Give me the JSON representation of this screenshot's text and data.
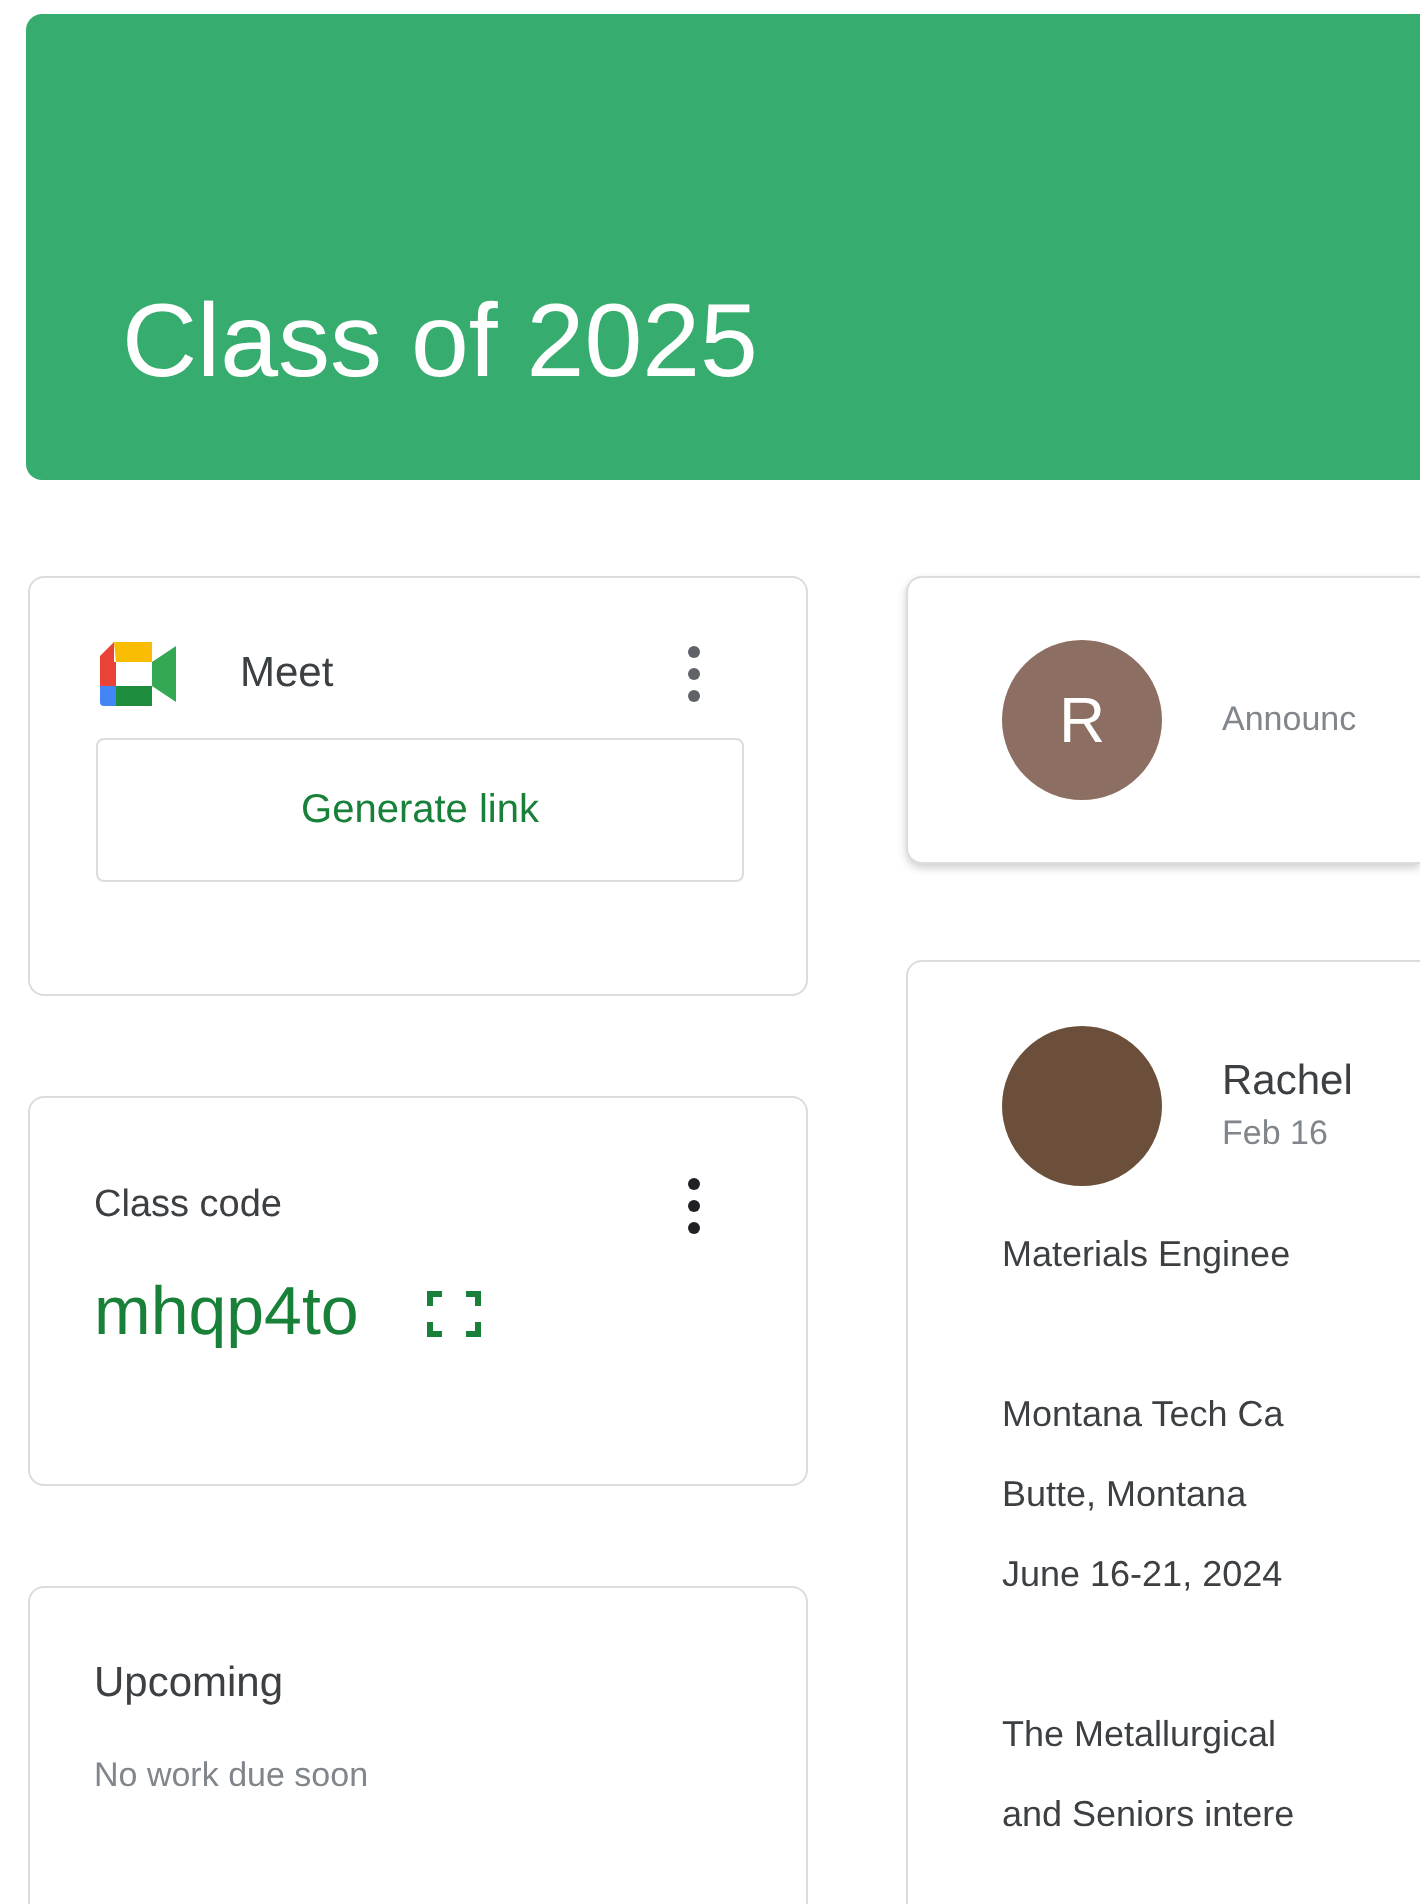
{
  "banner": {
    "title": "Class of 2025"
  },
  "meet": {
    "title": "Meet",
    "button": "Generate link"
  },
  "class_code": {
    "label": "Class code",
    "code": "mhqp4to"
  },
  "upcoming": {
    "title": "Upcoming",
    "message": "No work due soon"
  },
  "announce": {
    "avatar_letter": "R",
    "prompt": "Announc"
  },
  "post": {
    "author": "Rachel",
    "date": "Feb 16",
    "paragraphs": [
      [
        "Materials Enginee"
      ],
      [
        "Montana Tech Ca",
        "Butte, Montana",
        "June 16-21, 2024"
      ],
      [
        "The Metallurgical",
        "and Seniors intere"
      ]
    ]
  }
}
